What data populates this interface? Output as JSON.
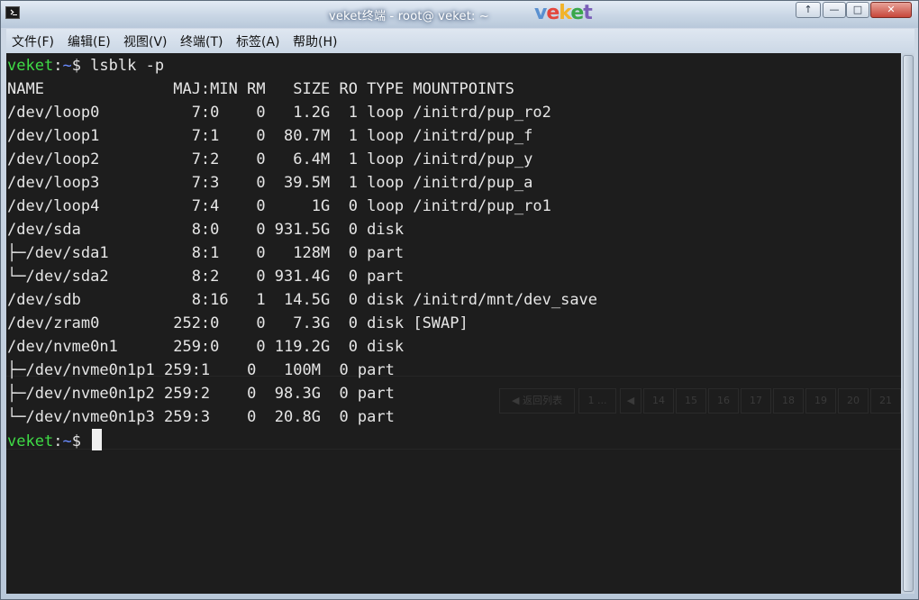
{
  "window": {
    "title": "veket终端 - root@ veket: ~",
    "brand_letters": [
      "v",
      "e",
      "k",
      "e",
      "t"
    ],
    "controls": {
      "up": "↑",
      "minimize": "—",
      "maximize": "□",
      "close": "✕"
    }
  },
  "menu": [
    "文件(F)",
    "编辑(E)",
    "视图(V)",
    "终端(T)",
    "标签(A)",
    "帮助(H)"
  ],
  "terminal": {
    "prompt_user": "veket",
    "prompt_sep": ":",
    "prompt_dir": "~",
    "prompt_sym": "$ ",
    "command": "lsblk -p",
    "lines": [
      "NAME              MAJ:MIN RM   SIZE RO TYPE MOUNTPOINTS",
      "/dev/loop0          7:0    0   1.2G  1 loop /initrd/pup_ro2",
      "/dev/loop1          7:1    0  80.7M  1 loop /initrd/pup_f",
      "/dev/loop2          7:2    0   6.4M  1 loop /initrd/pup_y",
      "/dev/loop3          7:3    0  39.5M  1 loop /initrd/pup_a",
      "/dev/loop4          7:4    0     1G  0 loop /initrd/pup_ro1",
      "/dev/sda            8:0    0 931.5G  0 disk",
      "├─/dev/sda1         8:1    0   128M  0 part",
      "└─/dev/sda2         8:2    0 931.4G  0 part",
      "/dev/sdb            8:16   1  14.5G  0 disk /initrd/mnt/dev_save",
      "/dev/zram0        252:0    0   7.3G  0 disk [SWAP]",
      "/dev/nvme0n1      259:0    0 119.2G  0 disk",
      "├─/dev/nvme0n1p1 259:1    0   100M  0 part",
      "├─/dev/nvme0n1p2 259:2    0  98.3G  0 part",
      "└─/dev/nvme0n1p3 259:3    0  20.8G  0 part"
    ]
  },
  "ghost_pager": [
    "◀ 返回列表",
    "1 ...",
    "◀",
    "14",
    "15",
    "16",
    "17",
    "18",
    "19",
    "20",
    "21"
  ]
}
